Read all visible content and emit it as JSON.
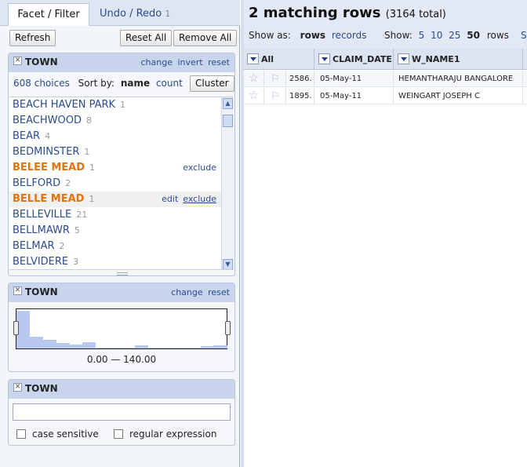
{
  "left_tabs": {
    "facet": "Facet / Filter",
    "undo": "Undo / Redo",
    "undo_count": "1"
  },
  "toolbar": {
    "refresh": "Refresh",
    "reset_all": "Reset All",
    "remove_all": "Remove All"
  },
  "facet1": {
    "title": "TOWN",
    "links": [
      "change",
      "invert",
      "reset"
    ],
    "choices_count": "608 choices",
    "sort_by": "Sort by:",
    "sort_name": "name",
    "sort_count": "count",
    "cluster": "Cluster",
    "items": [
      {
        "name": "BEACH HAVEN PARK",
        "count": "1"
      },
      {
        "name": "BEACHWOOD",
        "count": "8"
      },
      {
        "name": "BEAR",
        "count": "4"
      },
      {
        "name": "BEDMINSTER",
        "count": "1"
      },
      {
        "name": "BELEE MEAD",
        "count": "1",
        "selected": true,
        "action": "exclude"
      },
      {
        "name": "BELFORD",
        "count": "2"
      },
      {
        "name": "BELLE MEAD",
        "count": "1",
        "selected": true,
        "hover": true,
        "edit": "edit",
        "action": "exclude"
      },
      {
        "name": "BELLEVILLE",
        "count": "21"
      },
      {
        "name": "BELLMAWR",
        "count": "5"
      },
      {
        "name": "BELMAR",
        "count": "2"
      },
      {
        "name": "BELVIDERE",
        "count": "3"
      }
    ]
  },
  "facet2": {
    "title": "TOWN",
    "links": [
      "change",
      "reset"
    ],
    "range": "0.00 — 140.00",
    "bars": [
      0.95,
      0.3,
      0.22,
      0.13,
      0.1,
      0.16,
      0.02,
      0.02,
      0.02,
      0.08,
      0.02,
      0.02,
      0.01,
      0.02,
      0.06,
      0.08
    ]
  },
  "facet3": {
    "title": "TOWN",
    "text_value": "",
    "case_sensitive": "case sensitive",
    "regex": "regular expression"
  },
  "results": {
    "title": "2 matching rows",
    "total": "(3164 total)",
    "show_as": "Show as:",
    "rows": "rows",
    "records": "records",
    "show": "Show:",
    "page_sizes": [
      "5",
      "10",
      "25"
    ],
    "page_size_current": "50",
    "rows_suffix": "rows",
    "cut": "S"
  },
  "grid": {
    "columns": [
      "All",
      "CLAIM_DATE",
      "W_NAME1"
    ],
    "rows": [
      {
        "id": "2586.",
        "claim_date": "05-May-11",
        "name": "HEMANTHARAJU BANGALORE"
      },
      {
        "id": "1895.",
        "claim_date": "05-May-11",
        "name": "WEINGART JOSEPH C"
      }
    ]
  }
}
